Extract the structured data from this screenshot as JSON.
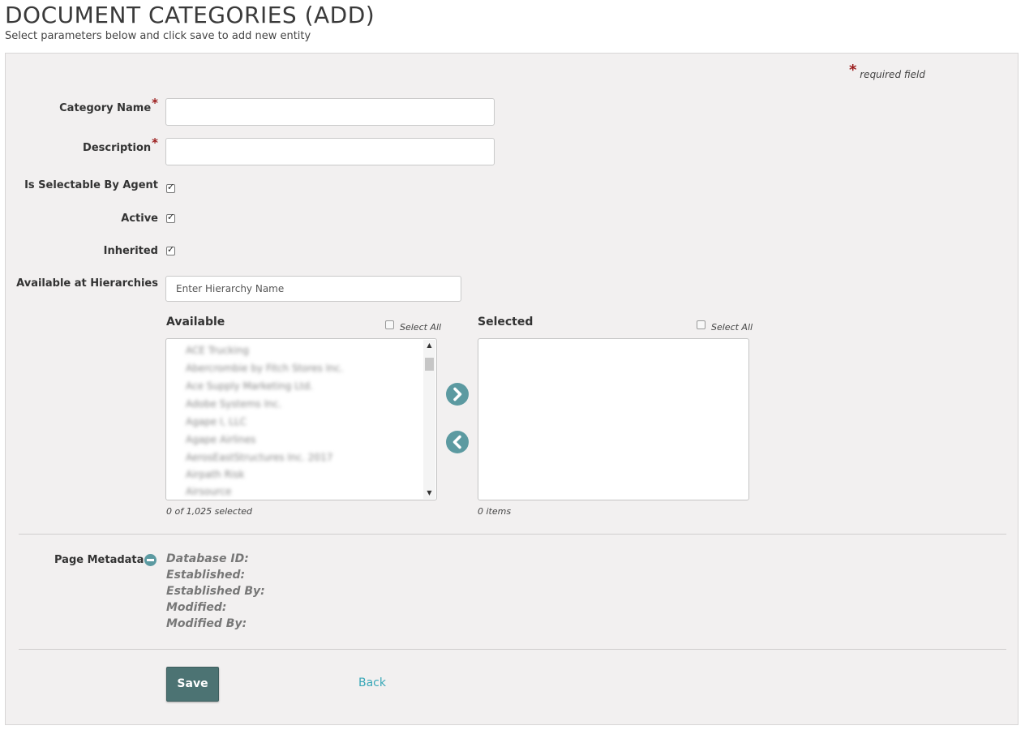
{
  "header": {
    "title": "DOCUMENT CATEGORIES (ADD)",
    "subtitle": "Select parameters below and click save to add new entity"
  },
  "form": {
    "required_star": "*",
    "required_note": "required field",
    "category_name": {
      "label": "Category Name",
      "value": ""
    },
    "description": {
      "label": "Description",
      "value": ""
    },
    "is_selectable_by_agent": {
      "label": "Is Selectable By Agent",
      "checked": true
    },
    "active": {
      "label": "Active",
      "checked": true
    },
    "inherited": {
      "label": "Inherited",
      "checked": true
    },
    "hierarchies": {
      "label": "Available at Hierarchies",
      "placeholder": "Enter Hierarchy Name"
    }
  },
  "dual_list": {
    "available": {
      "heading": "Available",
      "select_all_label": "Select All",
      "items": [
        "ACE Trucking",
        "Abercrombie by Fitch Stores Inc.",
        "Ace Supply Marketing Ltd.",
        "Adobe Systems Inc.",
        "Agape I, LLC",
        "Agape Airlines",
        "AerosEastStructures Inc. 2017",
        "Airpath Risk",
        "Airsource"
      ],
      "count_text": "0 of 1,025 selected"
    },
    "selected": {
      "heading": "Selected",
      "select_all_label": "Select All",
      "items": [],
      "count_text": "0 items"
    },
    "move_right_icon": "chevron-right-icon",
    "move_left_icon": "chevron-left-icon"
  },
  "metadata": {
    "label": "Page Metadata",
    "toggle_icon": "minus-circle-icon",
    "fields": [
      "Database ID:",
      "Established:",
      "Established By:",
      "Modified:",
      "Modified By:"
    ]
  },
  "actions": {
    "save_label": "Save",
    "back_label": "Back"
  },
  "colors": {
    "panel_bg": "#f2f0f0",
    "accent": "#5c9aa1",
    "save_button": "#4c7373",
    "link": "#3aa8b8",
    "required": "#9b1c1c"
  }
}
